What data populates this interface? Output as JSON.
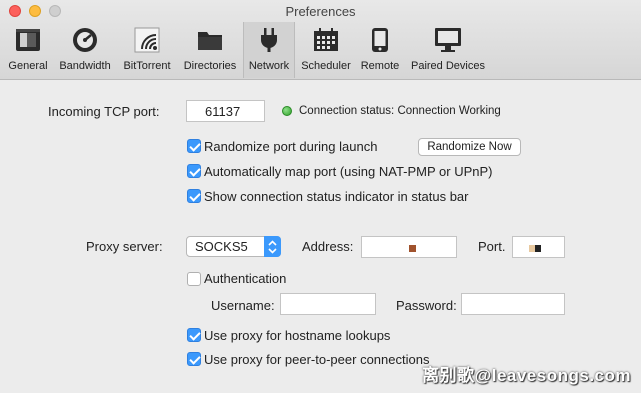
{
  "window": {
    "title": "Preferences"
  },
  "toolbar": {
    "tabs": [
      {
        "label": "General",
        "icon": "general-icon"
      },
      {
        "label": "Bandwidth",
        "icon": "speedometer-icon"
      },
      {
        "label": "BitTorrent",
        "icon": "bittorrent-icon"
      },
      {
        "label": "Directories",
        "icon": "folder-icon"
      },
      {
        "label": "Network",
        "icon": "plug-icon",
        "active": true
      },
      {
        "label": "Scheduler",
        "icon": "calendar-icon"
      },
      {
        "label": "Remote",
        "icon": "phone-icon"
      },
      {
        "label": "Paired Devices",
        "icon": "monitor-icon"
      }
    ]
  },
  "network": {
    "port_label": "Incoming TCP port:",
    "port_value": "61137",
    "status_text": "Connection status: Connection Working",
    "randomize_label": "Randomize port during launch",
    "randomize_button": "Randomize Now",
    "automap_label": "Automatically map port (using NAT-PMP or UPnP)",
    "show_status_label": "Show connection status indicator in status bar"
  },
  "proxy": {
    "server_label": "Proxy server:",
    "server_value": "SOCKS5",
    "address_label": "Address:",
    "port_label": "Port.",
    "auth_label": "Authentication",
    "username_label": "Username:",
    "password_label": "Password:",
    "hostname_label": "Use proxy for hostname lookups",
    "p2p_label": "Use proxy for peer-to-peer connections"
  },
  "checkbox_states": {
    "randomize": true,
    "automap": true,
    "show_status": true,
    "authentication": false,
    "hostname": true,
    "p2p": true
  },
  "watermark": "离别歌@leavesongs.com",
  "colors": {
    "accent": "#3b99fc",
    "status_ok": "#2fa12a"
  }
}
